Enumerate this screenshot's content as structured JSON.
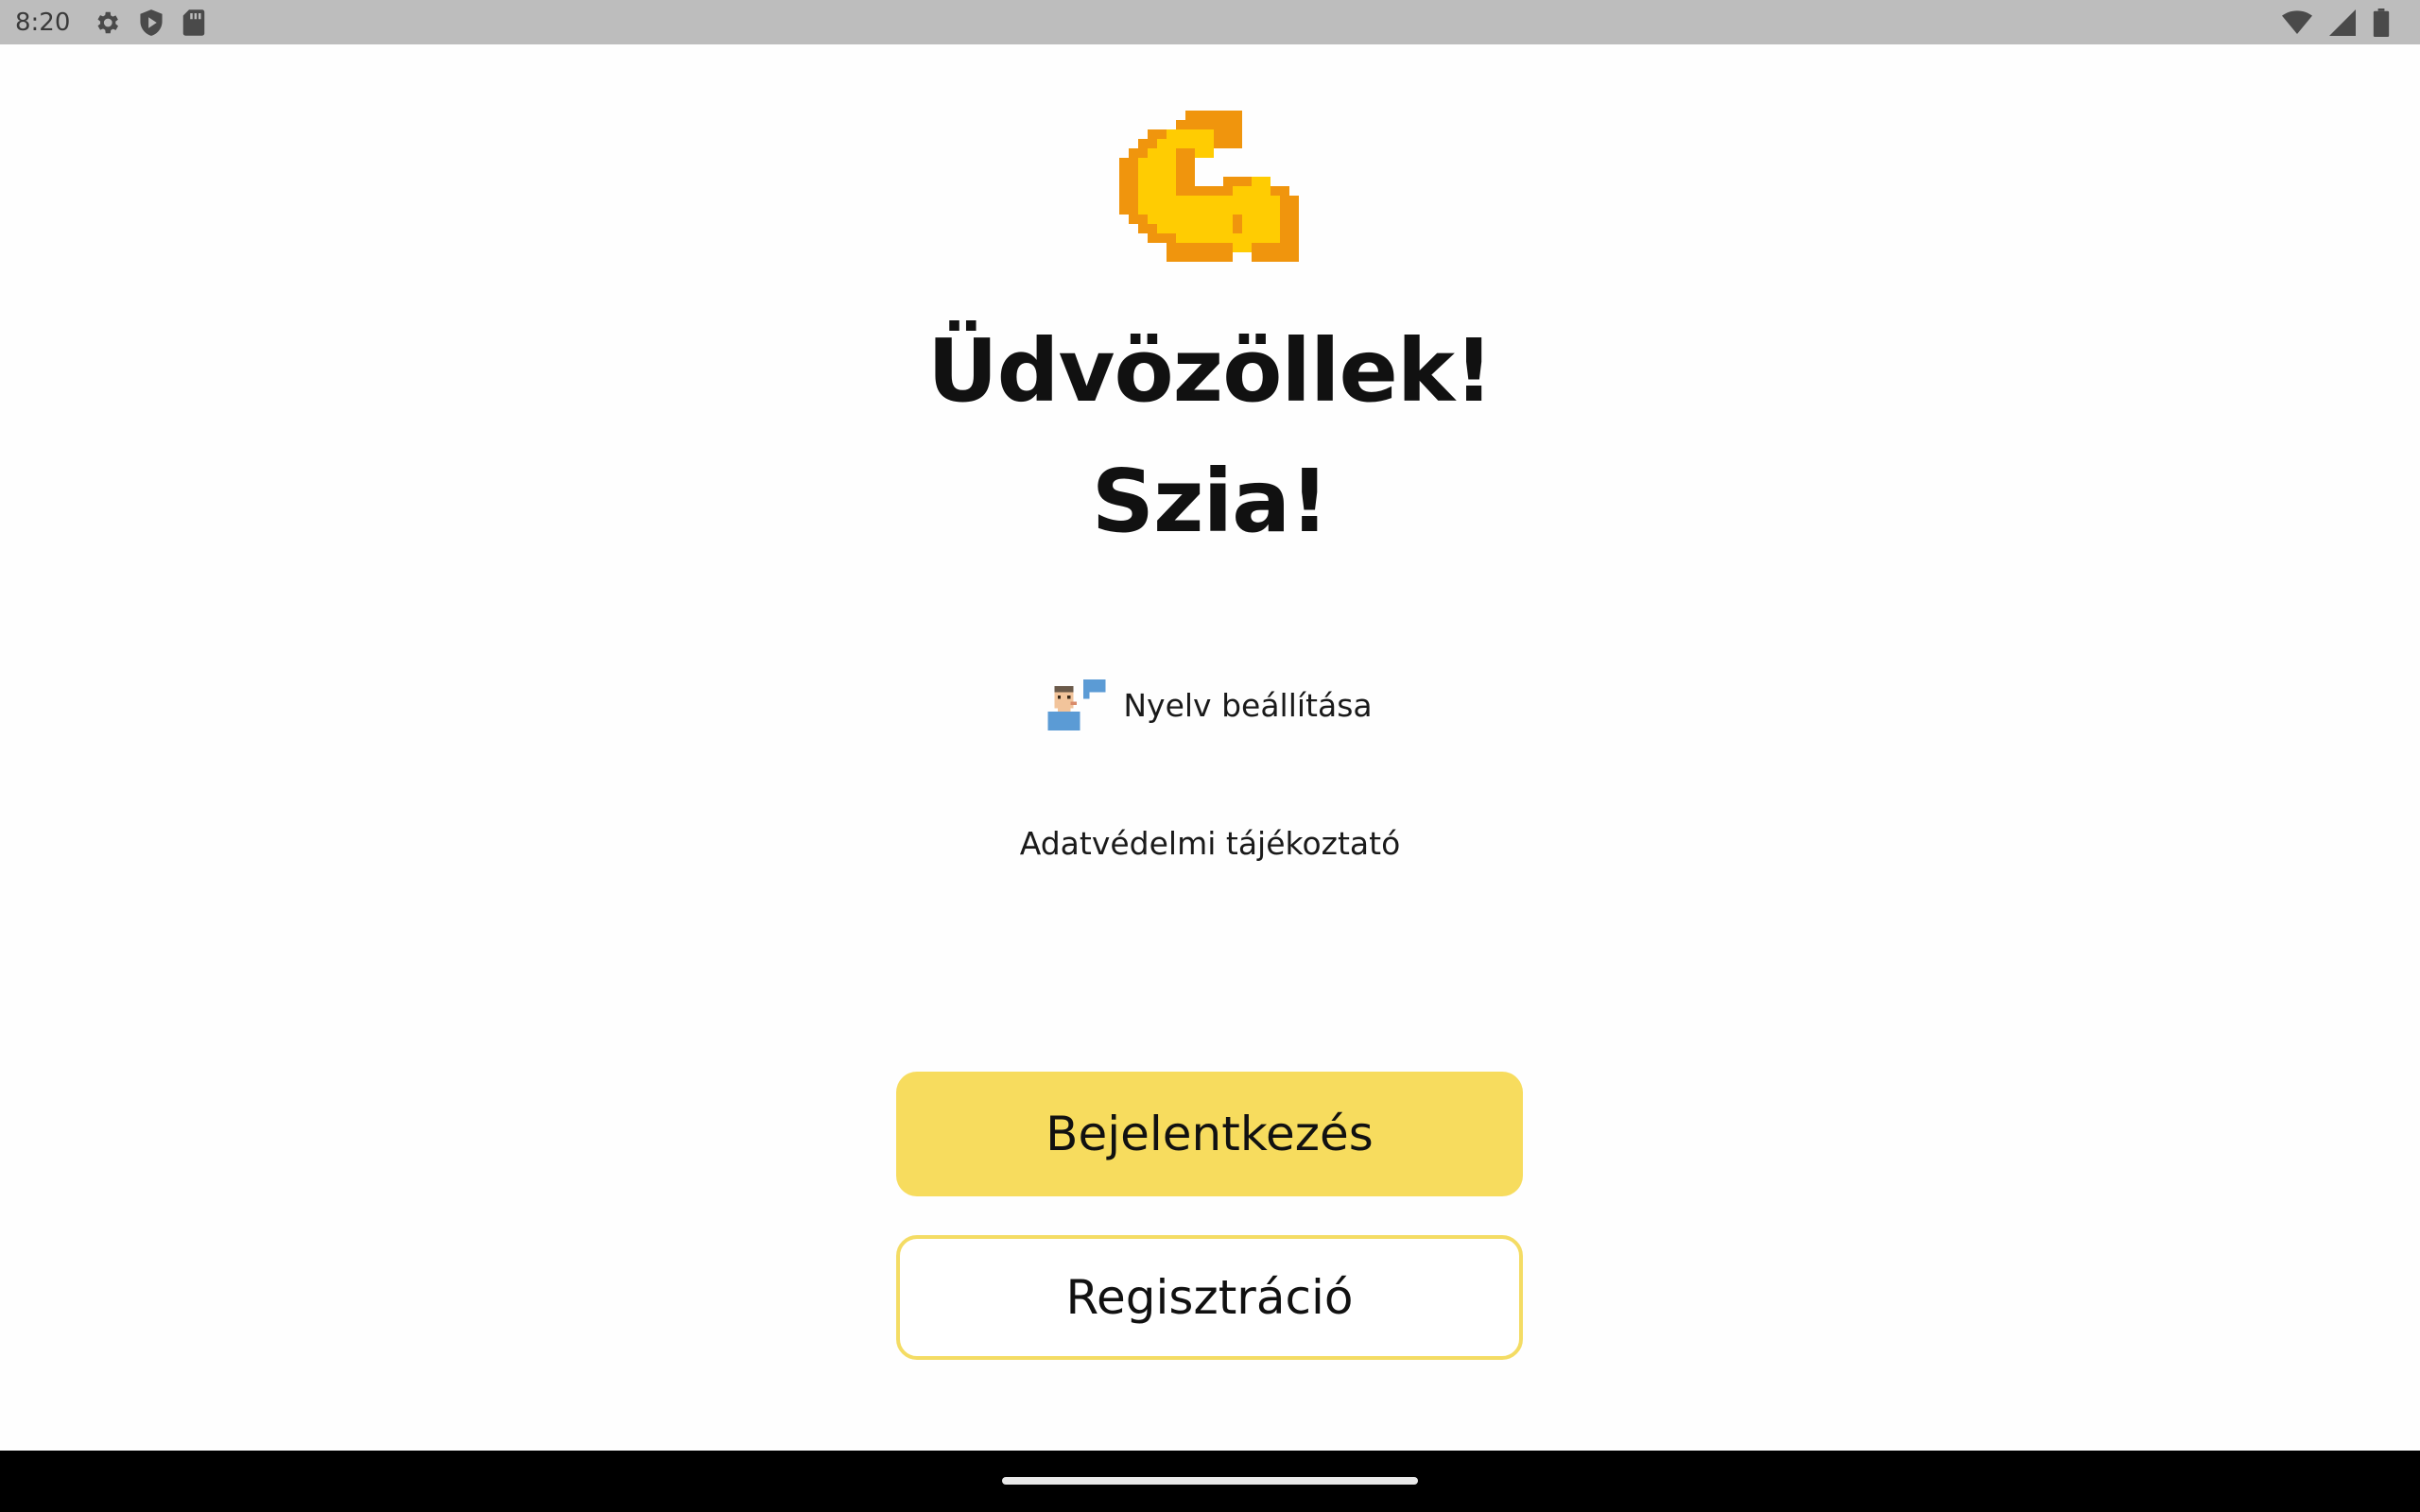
{
  "status_bar": {
    "time": "8:20",
    "left_icons": [
      "settings-icon",
      "shield-play-icon",
      "sd-card-icon"
    ],
    "right_icons": [
      "wifi-icon",
      "cellular-signal-icon",
      "battery-icon"
    ]
  },
  "welcome": {
    "logo_icon": "flexed-biceps-icon",
    "title_line1": "Üdvözöllek!",
    "title_line2": "Szia!"
  },
  "language": {
    "icon": "speaking-person-icon",
    "label": "Nyelv beállítása"
  },
  "privacy": {
    "label": "Adatvédelmi tájékoztató"
  },
  "buttons": {
    "login_label": "Bejelentkezés",
    "register_label": "Regisztráció"
  },
  "colors": {
    "accent_yellow": "#f7dc5e",
    "outline_yellow": "#f4dc64",
    "status_bar_bg": "#bdbdbd",
    "nav_bar_bg": "#000000"
  }
}
